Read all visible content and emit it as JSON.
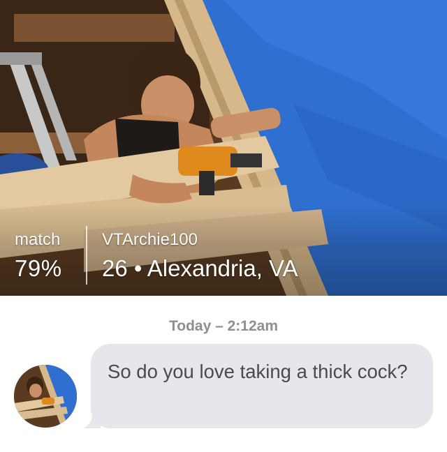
{
  "profile": {
    "match_label": "match",
    "match_value": "79%",
    "username": "VTArchie100",
    "details": "26 • Alexandria, VA"
  },
  "conversation": {
    "timestamp": "Today – 2:12am",
    "messages": [
      {
        "sender": "VTArchie100",
        "text": "So do you love taking a thick cock?"
      }
    ]
  },
  "colors": {
    "bubble": "#e6e6eb",
    "timestamp": "#8e8e93",
    "tarp": "#2f6fd0"
  }
}
